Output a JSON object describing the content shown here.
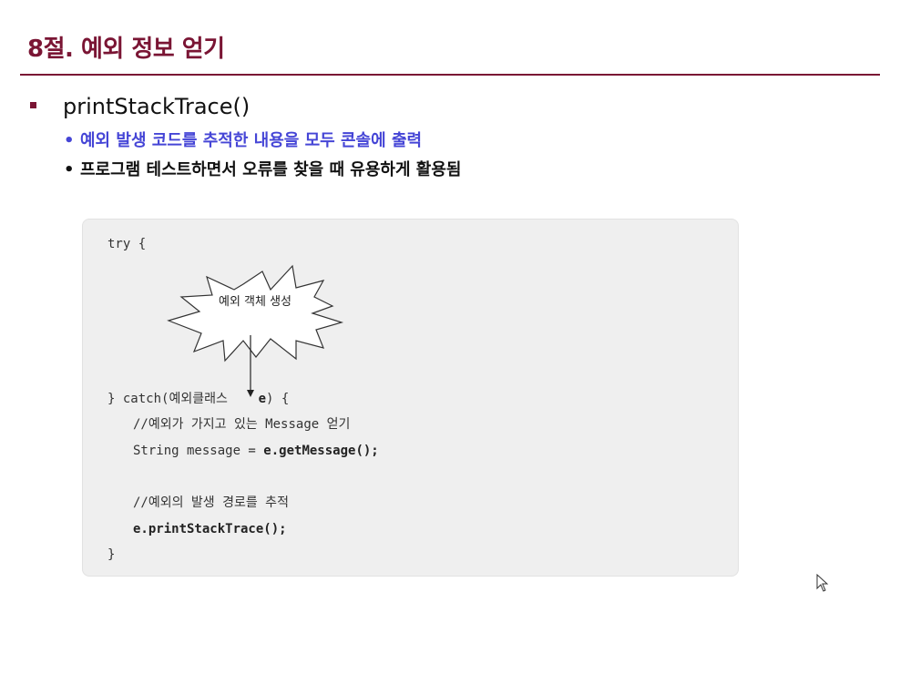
{
  "slide": {
    "title": "8절. 예외 정보 얻기"
  },
  "main_bullet": {
    "label": "printStackTrace()"
  },
  "sub_bullets": [
    {
      "dot": "•",
      "text": "예외 발생 코드를 추적한 내용을 모두 콘솔에 출력"
    },
    {
      "dot": "•",
      "text": "프로그램 테스트하면서 오류를 찾을 때 유용하게 활용됨"
    }
  ],
  "code": {
    "line_try": "try {",
    "burst_label": "예외 객체 생성",
    "catch_prefix": "} catch(",
    "catch_class": "예외클래스",
    "catch_var": "e",
    "catch_suffix": ") {",
    "comment_1": "//예외가 가지고 있는 Message 얻기",
    "message_prefix": "String message = ",
    "message_call": "e.getMessage();",
    "comment_2": "//예외의 발생 경로를 추적",
    "trace_call": "e.printStackTrace();",
    "close_brace": "}"
  },
  "colors": {
    "title": "#7a1534",
    "sub_bullet_1": "#4545d6",
    "panel_bg": "#efefef"
  },
  "icons": {
    "bullet": "square-bullet-icon",
    "burst": "starburst-shape",
    "arrow": "down-arrow-icon",
    "cursor": "mouse-pointer-icon"
  }
}
